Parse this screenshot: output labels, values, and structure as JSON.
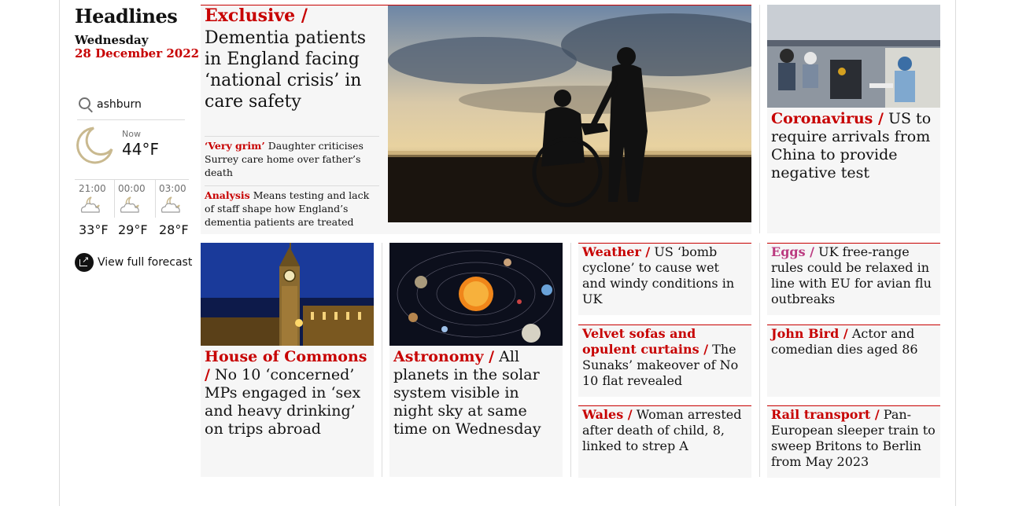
{
  "sidebar": {
    "title": "Headlines",
    "day": "Wednesday",
    "date": "28 December 2022",
    "search_value": "ashburn",
    "now_label": "Now",
    "now_temp": "44°F",
    "hours": [
      {
        "time": "21:00",
        "temp": "33°F",
        "icon": "partly-cloudy-night-icon"
      },
      {
        "time": "00:00",
        "temp": "29°F",
        "icon": "partly-cloudy-night-icon"
      },
      {
        "time": "03:00",
        "temp": "28°F",
        "icon": "partly-cloudy-night-icon"
      }
    ],
    "forecast_link": "View full forecast"
  },
  "lead": {
    "kicker": "Exclusive /",
    "headline": "Dementia patients in England facing ‘national crisis’ in care safety",
    "subs": [
      {
        "kicker": "‘Very grim’",
        "text": "Daughter criticises Surrey care home over father’s death"
      },
      {
        "kicker": "Analysis",
        "text": "Means testing and lack of staff shape how England’s dementia patients are treated"
      }
    ]
  },
  "corona": {
    "kicker": "Coronavirus /",
    "text": "US to require arrivals from China to provide negative test"
  },
  "commons": {
    "kicker": "House of Commons /",
    "text": "No 10 ‘concerned’ MPs engaged in ‘sex and heavy drinking’ on trips abroad"
  },
  "astronomy": {
    "kicker": "Astronomy /",
    "text": "All planets in the solar system visible in night sky at same time on Wednesday"
  },
  "small_cards": [
    {
      "kicker": "Weather /",
      "text": "US ‘bomb cyclone’ to cause wet and windy conditions in UK"
    },
    {
      "kicker": "Eggs /",
      "text": "UK free-range rules could be relaxed in line with EU for avian flu outbreaks"
    },
    {
      "kicker": "Velvet sofas and opulent curtains /",
      "text": "The Sunaks’ makeover of No 10 flat revealed"
    },
    {
      "kicker": "John Bird /",
      "text": "Actor and comedian dies aged 86"
    },
    {
      "kicker": "Wales /",
      "text": "Woman arrested after death of child, 8, linked to strep A"
    },
    {
      "kicker": "Rail transport /",
      "text": "Pan-European sleeper train to sweep Britons to Berlin from May 2023"
    }
  ],
  "colors": {
    "accent": "#c70000",
    "pink_accent": "#bb3b80",
    "card_bg": "#f6f6f6"
  }
}
